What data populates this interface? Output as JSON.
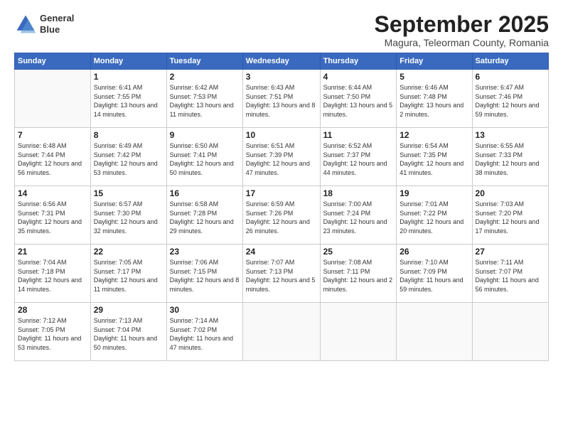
{
  "header": {
    "logo_line1": "General",
    "logo_line2": "Blue",
    "month": "September 2025",
    "location": "Magura, Teleorman County, Romania"
  },
  "weekdays": [
    "Sunday",
    "Monday",
    "Tuesday",
    "Wednesday",
    "Thursday",
    "Friday",
    "Saturday"
  ],
  "weeks": [
    [
      {
        "day": "",
        "sunrise": "",
        "sunset": "",
        "daylight": ""
      },
      {
        "day": "1",
        "sunrise": "Sunrise: 6:41 AM",
        "sunset": "Sunset: 7:55 PM",
        "daylight": "Daylight: 13 hours and 14 minutes."
      },
      {
        "day": "2",
        "sunrise": "Sunrise: 6:42 AM",
        "sunset": "Sunset: 7:53 PM",
        "daylight": "Daylight: 13 hours and 11 minutes."
      },
      {
        "day": "3",
        "sunrise": "Sunrise: 6:43 AM",
        "sunset": "Sunset: 7:51 PM",
        "daylight": "Daylight: 13 hours and 8 minutes."
      },
      {
        "day": "4",
        "sunrise": "Sunrise: 6:44 AM",
        "sunset": "Sunset: 7:50 PM",
        "daylight": "Daylight: 13 hours and 5 minutes."
      },
      {
        "day": "5",
        "sunrise": "Sunrise: 6:46 AM",
        "sunset": "Sunset: 7:48 PM",
        "daylight": "Daylight: 13 hours and 2 minutes."
      },
      {
        "day": "6",
        "sunrise": "Sunrise: 6:47 AM",
        "sunset": "Sunset: 7:46 PM",
        "daylight": "Daylight: 12 hours and 59 minutes."
      }
    ],
    [
      {
        "day": "7",
        "sunrise": "Sunrise: 6:48 AM",
        "sunset": "Sunset: 7:44 PM",
        "daylight": "Daylight: 12 hours and 56 minutes."
      },
      {
        "day": "8",
        "sunrise": "Sunrise: 6:49 AM",
        "sunset": "Sunset: 7:42 PM",
        "daylight": "Daylight: 12 hours and 53 minutes."
      },
      {
        "day": "9",
        "sunrise": "Sunrise: 6:50 AM",
        "sunset": "Sunset: 7:41 PM",
        "daylight": "Daylight: 12 hours and 50 minutes."
      },
      {
        "day": "10",
        "sunrise": "Sunrise: 6:51 AM",
        "sunset": "Sunset: 7:39 PM",
        "daylight": "Daylight: 12 hours and 47 minutes."
      },
      {
        "day": "11",
        "sunrise": "Sunrise: 6:52 AM",
        "sunset": "Sunset: 7:37 PM",
        "daylight": "Daylight: 12 hours and 44 minutes."
      },
      {
        "day": "12",
        "sunrise": "Sunrise: 6:54 AM",
        "sunset": "Sunset: 7:35 PM",
        "daylight": "Daylight: 12 hours and 41 minutes."
      },
      {
        "day": "13",
        "sunrise": "Sunrise: 6:55 AM",
        "sunset": "Sunset: 7:33 PM",
        "daylight": "Daylight: 12 hours and 38 minutes."
      }
    ],
    [
      {
        "day": "14",
        "sunrise": "Sunrise: 6:56 AM",
        "sunset": "Sunset: 7:31 PM",
        "daylight": "Daylight: 12 hours and 35 minutes."
      },
      {
        "day": "15",
        "sunrise": "Sunrise: 6:57 AM",
        "sunset": "Sunset: 7:30 PM",
        "daylight": "Daylight: 12 hours and 32 minutes."
      },
      {
        "day": "16",
        "sunrise": "Sunrise: 6:58 AM",
        "sunset": "Sunset: 7:28 PM",
        "daylight": "Daylight: 12 hours and 29 minutes."
      },
      {
        "day": "17",
        "sunrise": "Sunrise: 6:59 AM",
        "sunset": "Sunset: 7:26 PM",
        "daylight": "Daylight: 12 hours and 26 minutes."
      },
      {
        "day": "18",
        "sunrise": "Sunrise: 7:00 AM",
        "sunset": "Sunset: 7:24 PM",
        "daylight": "Daylight: 12 hours and 23 minutes."
      },
      {
        "day": "19",
        "sunrise": "Sunrise: 7:01 AM",
        "sunset": "Sunset: 7:22 PM",
        "daylight": "Daylight: 12 hours and 20 minutes."
      },
      {
        "day": "20",
        "sunrise": "Sunrise: 7:03 AM",
        "sunset": "Sunset: 7:20 PM",
        "daylight": "Daylight: 12 hours and 17 minutes."
      }
    ],
    [
      {
        "day": "21",
        "sunrise": "Sunrise: 7:04 AM",
        "sunset": "Sunset: 7:18 PM",
        "daylight": "Daylight: 12 hours and 14 minutes."
      },
      {
        "day": "22",
        "sunrise": "Sunrise: 7:05 AM",
        "sunset": "Sunset: 7:17 PM",
        "daylight": "Daylight: 12 hours and 11 minutes."
      },
      {
        "day": "23",
        "sunrise": "Sunrise: 7:06 AM",
        "sunset": "Sunset: 7:15 PM",
        "daylight": "Daylight: 12 hours and 8 minutes."
      },
      {
        "day": "24",
        "sunrise": "Sunrise: 7:07 AM",
        "sunset": "Sunset: 7:13 PM",
        "daylight": "Daylight: 12 hours and 5 minutes."
      },
      {
        "day": "25",
        "sunrise": "Sunrise: 7:08 AM",
        "sunset": "Sunset: 7:11 PM",
        "daylight": "Daylight: 12 hours and 2 minutes."
      },
      {
        "day": "26",
        "sunrise": "Sunrise: 7:10 AM",
        "sunset": "Sunset: 7:09 PM",
        "daylight": "Daylight: 11 hours and 59 minutes."
      },
      {
        "day": "27",
        "sunrise": "Sunrise: 7:11 AM",
        "sunset": "Sunset: 7:07 PM",
        "daylight": "Daylight: 11 hours and 56 minutes."
      }
    ],
    [
      {
        "day": "28",
        "sunrise": "Sunrise: 7:12 AM",
        "sunset": "Sunset: 7:05 PM",
        "daylight": "Daylight: 11 hours and 53 minutes."
      },
      {
        "day": "29",
        "sunrise": "Sunrise: 7:13 AM",
        "sunset": "Sunset: 7:04 PM",
        "daylight": "Daylight: 11 hours and 50 minutes."
      },
      {
        "day": "30",
        "sunrise": "Sunrise: 7:14 AM",
        "sunset": "Sunset: 7:02 PM",
        "daylight": "Daylight: 11 hours and 47 minutes."
      },
      {
        "day": "",
        "sunrise": "",
        "sunset": "",
        "daylight": ""
      },
      {
        "day": "",
        "sunrise": "",
        "sunset": "",
        "daylight": ""
      },
      {
        "day": "",
        "sunrise": "",
        "sunset": "",
        "daylight": ""
      },
      {
        "day": "",
        "sunrise": "",
        "sunset": "",
        "daylight": ""
      }
    ]
  ]
}
